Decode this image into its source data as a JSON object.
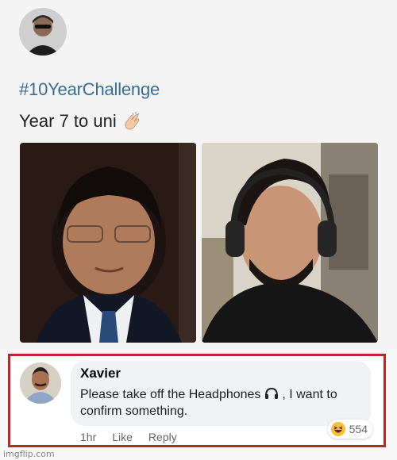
{
  "post": {
    "hashtag": "#10YearChallenge",
    "caption": "Year 7 to uni",
    "caption_icon": "clapping-hands-icon"
  },
  "comment": {
    "author": "Xavier",
    "text_before_icon": "Please take off the Headphones",
    "inline_icon": "headphones-icon",
    "text_after_icon": ", I want to confirm something.",
    "reaction_icon": "haha-emoji-icon",
    "reaction_count": "554",
    "time": "1hr",
    "like_label": "Like",
    "reply_label": "Reply"
  },
  "watermark": "imgflip.com",
  "colors": {
    "hashtag": "#3a6d95",
    "highlight_border": "#b52b2b",
    "bubble": "#f0f2f5"
  }
}
